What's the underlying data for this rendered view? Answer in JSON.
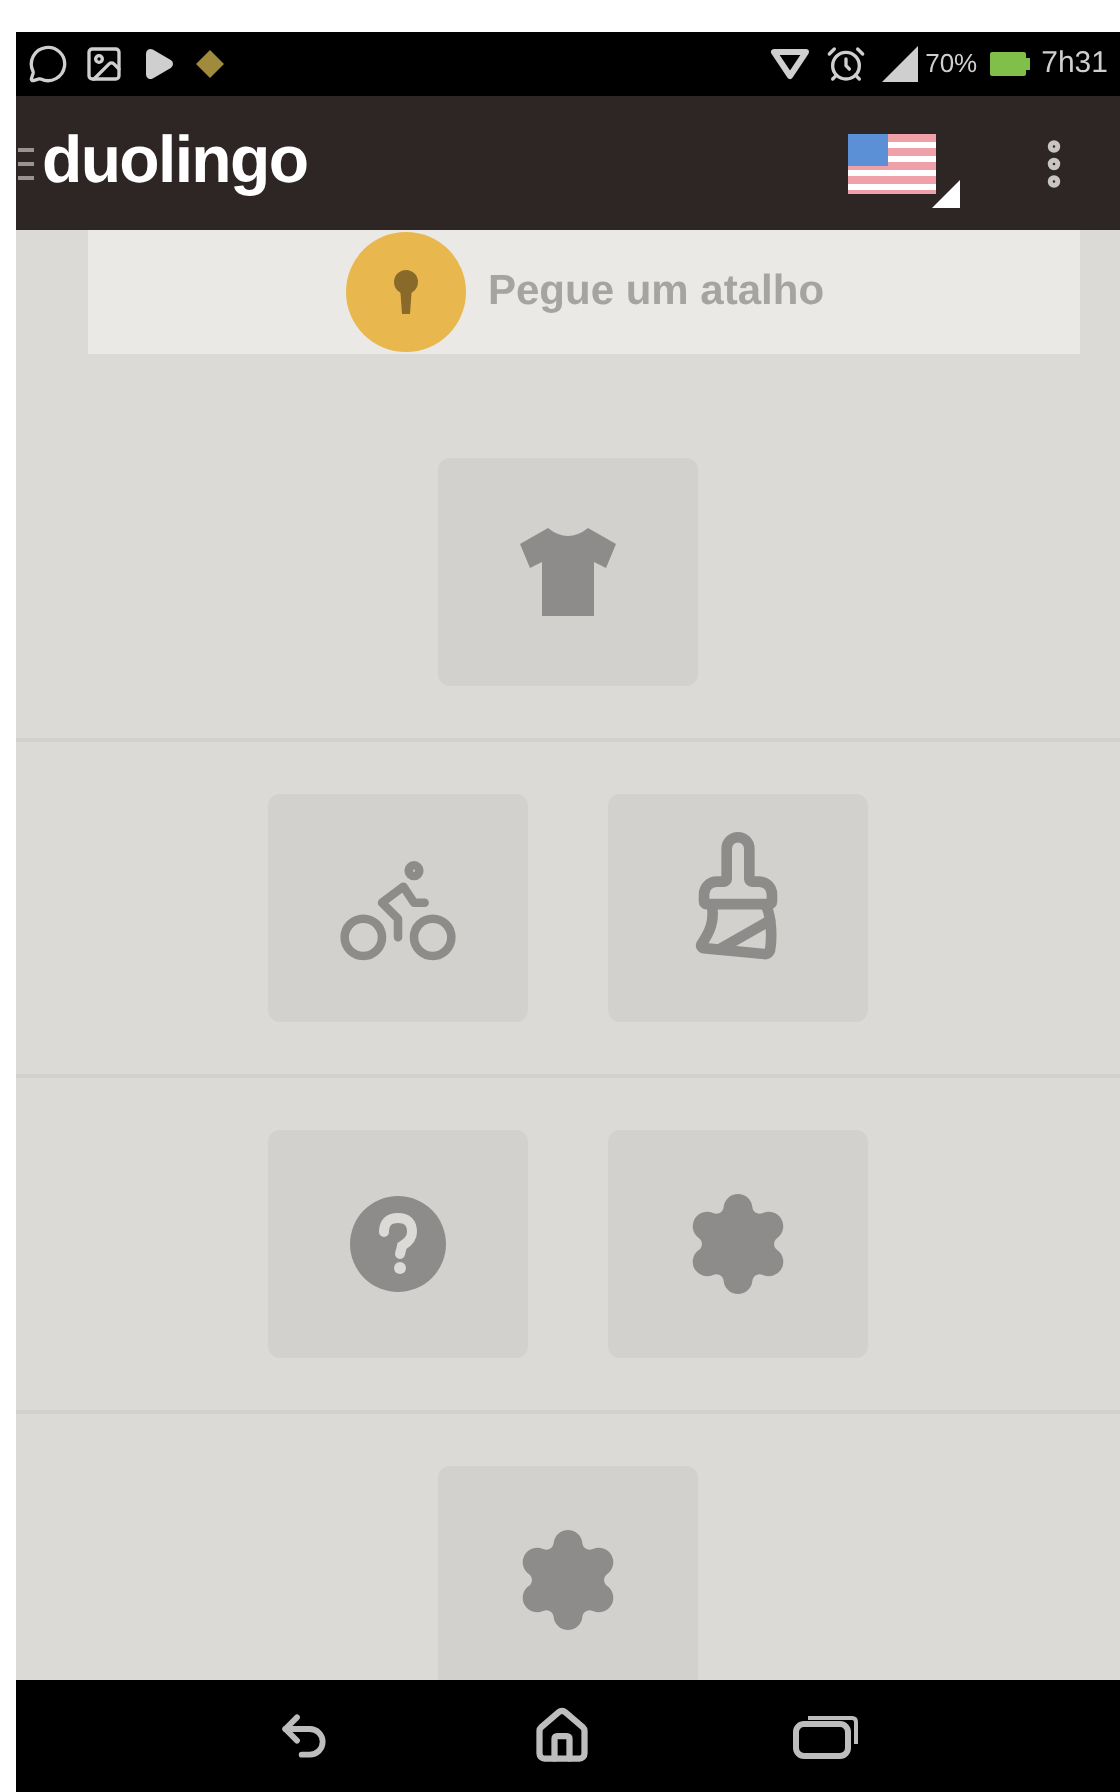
{
  "status_bar": {
    "battery": "70%",
    "time": "7h31"
  },
  "app_bar": {
    "logo": "duolingo"
  },
  "shortcut": {
    "label": "Pegue um atalho"
  },
  "rows": [
    {
      "tiles": [
        {
          "kind": "shirt"
        }
      ]
    },
    {
      "tiles": [
        {
          "kind": "bike"
        },
        {
          "kind": "paintbrush"
        }
      ]
    },
    {
      "tiles": [
        {
          "kind": "help"
        },
        {
          "kind": "gear"
        }
      ]
    },
    {
      "tiles": [
        {
          "kind": "gear"
        }
      ]
    }
  ]
}
